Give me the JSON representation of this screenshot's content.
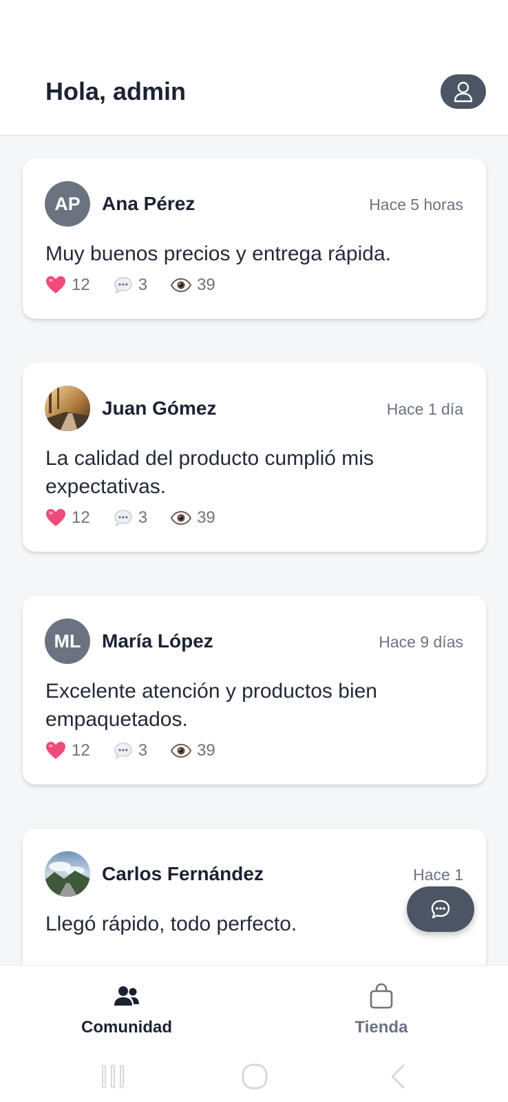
{
  "header": {
    "greeting": "Hola, admin",
    "profile_icon": "user-icon"
  },
  "posts": [
    {
      "initials": "AP",
      "author": "Ana Pérez",
      "time": "Hace 5 horas",
      "text": "Muy buenos precios y entrega rápida.",
      "likes": "12",
      "comments": "3",
      "views": "39"
    },
    {
      "initials": "",
      "author": "Juan Gómez",
      "time": "Hace 1 día",
      "text": "La calidad del producto cumplió mis expectativas.",
      "likes": "12",
      "comments": "3",
      "views": "39"
    },
    {
      "initials": "ML",
      "author": "María López",
      "time": "Hace 9 días",
      "text": "Excelente atención y productos bien empaquetados.",
      "likes": "12",
      "comments": "3",
      "views": "39"
    },
    {
      "initials": "",
      "author": "Carlos Fernández",
      "time": "Hace 1",
      "text": "Llegó rápido, todo perfecto."
    }
  ],
  "fab": {
    "icon": "chat-icon"
  },
  "bottom_nav": {
    "items": [
      {
        "label": "Comunidad",
        "icon": "community-icon",
        "active": true
      },
      {
        "label": "Tienda",
        "icon": "shopping-bag-icon",
        "active": false
      }
    ]
  },
  "colors": {
    "background": "#f4f6f8",
    "card": "#ffffff",
    "accent_dark": "#4b5563",
    "text_primary": "#1b2232",
    "text_secondary": "#6b7280",
    "heart": "#ef4b7a"
  }
}
